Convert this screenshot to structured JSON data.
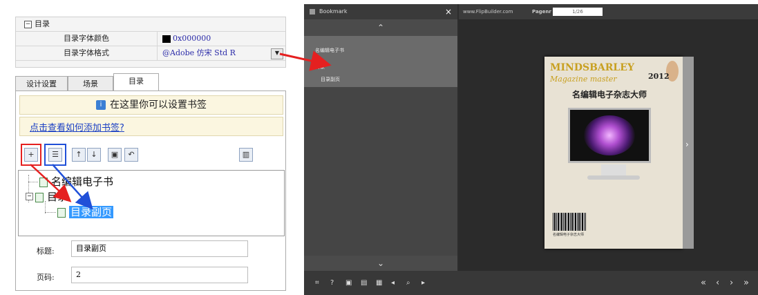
{
  "left_panel": {
    "property_grid": {
      "group_label": "目录",
      "rows": [
        {
          "name": "目录字体颜色",
          "value": "0x000000"
        },
        {
          "name": "目录字体格式",
          "value": "@Adobe 仿宋 Std R"
        }
      ]
    },
    "tabs": [
      "设计设置",
      "场景",
      "目录"
    ],
    "hint_text": "在这里你可以设置书签",
    "help_link": "点击查看如何添加书签?",
    "toolbar_icons": [
      "add-icon",
      "add-sub-icon",
      "move-up-icon",
      "move-down-icon",
      "save-icon",
      "undo-icon",
      "delete-icon"
    ],
    "tree": [
      {
        "label": "名编辑电子书",
        "level": 0
      },
      {
        "label": "目录",
        "level": 0
      },
      {
        "label": "目录副页",
        "level": 1,
        "selected": true
      }
    ],
    "fields": {
      "title_label": "标题:",
      "title_value": "目录副页",
      "page_label": "页码:",
      "page_value": "2"
    }
  },
  "viewer": {
    "bookmark_panel": {
      "title": "Bookmark",
      "close": "×",
      "up": "⌃",
      "down": "⌄",
      "items": [
        "名编辑电子书",
        "目录",
        "目录副页"
      ]
    },
    "topbar": {
      "site": "www.FlipBuilder.com",
      "page_label": "Pagenr",
      "page_value": "1/26"
    },
    "cover": {
      "title": "MINDSBARLEY",
      "subtitle": "Magazine master",
      "year": "2012",
      "chinese_title": "名编辑电子杂志大师",
      "footer": "名编辑电子杂志大师"
    },
    "next_arrow": "›",
    "bottom_left_icons": [
      "fullscreen-icon",
      "help-icon",
      "print-icon",
      "share-icon",
      "thumbnails-icon",
      "sound-icon",
      "zoom-icon",
      "autoplay-icon"
    ],
    "bottom_left_glyphs": [
      "⌗",
      "?",
      "▣",
      "▤",
      "▦",
      "◂",
      "⌕",
      "▸"
    ],
    "bottom_right_glyphs": [
      "«",
      "‹",
      "›",
      "»"
    ]
  },
  "colors": {
    "annotation_red": "#e52020",
    "annotation_blue": "#2050d8",
    "selection": "#3399ff"
  }
}
